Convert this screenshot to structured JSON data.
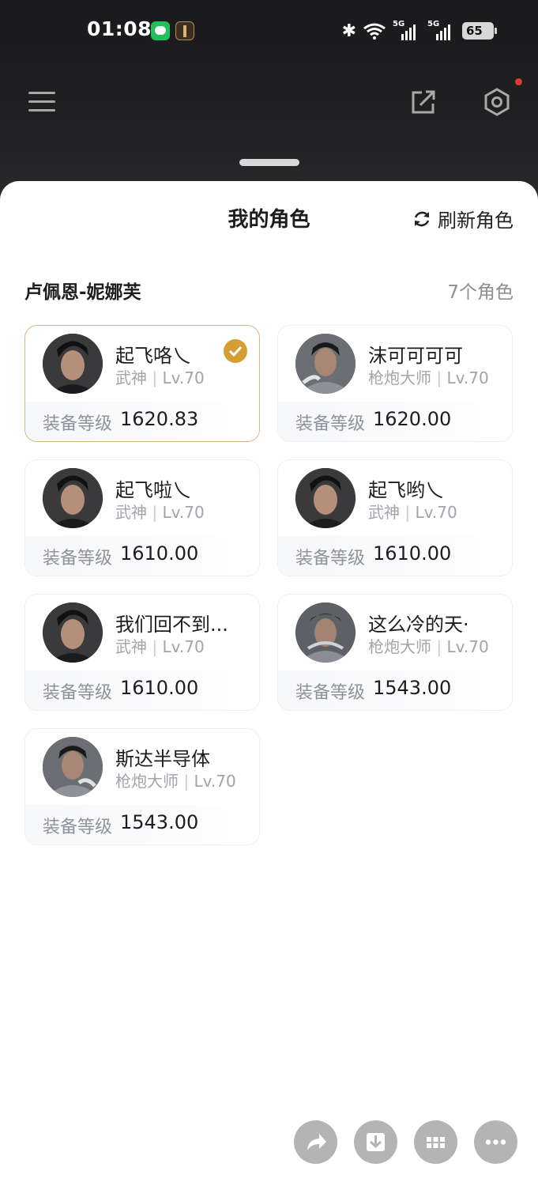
{
  "status_bar": {
    "time": "01:08",
    "network_1": "5G",
    "network_2": "5G",
    "battery": "65"
  },
  "sheet": {
    "title": "我的角色",
    "refresh_label": "刷新角色"
  },
  "server": {
    "name": "卢佩恩-妮娜芙",
    "count": "7个角色"
  },
  "gear_label": "装备等级",
  "characters": [
    {
      "name": "起飞咯乀",
      "class": "武神",
      "level": "Lv.70",
      "gear": "1620.83",
      "selected": true
    },
    {
      "name": "沫可可可可",
      "class": "枪炮大师",
      "level": "Lv.70",
      "gear": "1620.00",
      "selected": false
    },
    {
      "name": "起飞啦乀",
      "class": "武神",
      "level": "Lv.70",
      "gear": "1610.00",
      "selected": false
    },
    {
      "name": "起飞哟乀",
      "class": "武神",
      "level": "Lv.70",
      "gear": "1610.00",
      "selected": false
    },
    {
      "name": "我们回不到...",
      "class": "武神",
      "level": "Lv.70",
      "gear": "1610.00",
      "selected": false
    },
    {
      "name": "这么冷的天·",
      "class": "枪炮大师",
      "level": "Lv.70",
      "gear": "1543.00",
      "selected": false
    },
    {
      "name": "斯达半导体",
      "class": "枪炮大师",
      "level": "Lv.70",
      "gear": "1543.00",
      "selected": false
    }
  ],
  "colors": {
    "accent_gold": "#d39f33",
    "selected_border": "#d9b77d",
    "notification": "#d2412f"
  },
  "icons": {
    "top_left": "menu-icon",
    "top_share": "share-icon",
    "top_settings": "hexagon-settings-icon",
    "refresh": "refresh-icon",
    "fab": [
      "share-arrow-icon",
      "download-icon",
      "grid-icon",
      "more-icon"
    ]
  }
}
